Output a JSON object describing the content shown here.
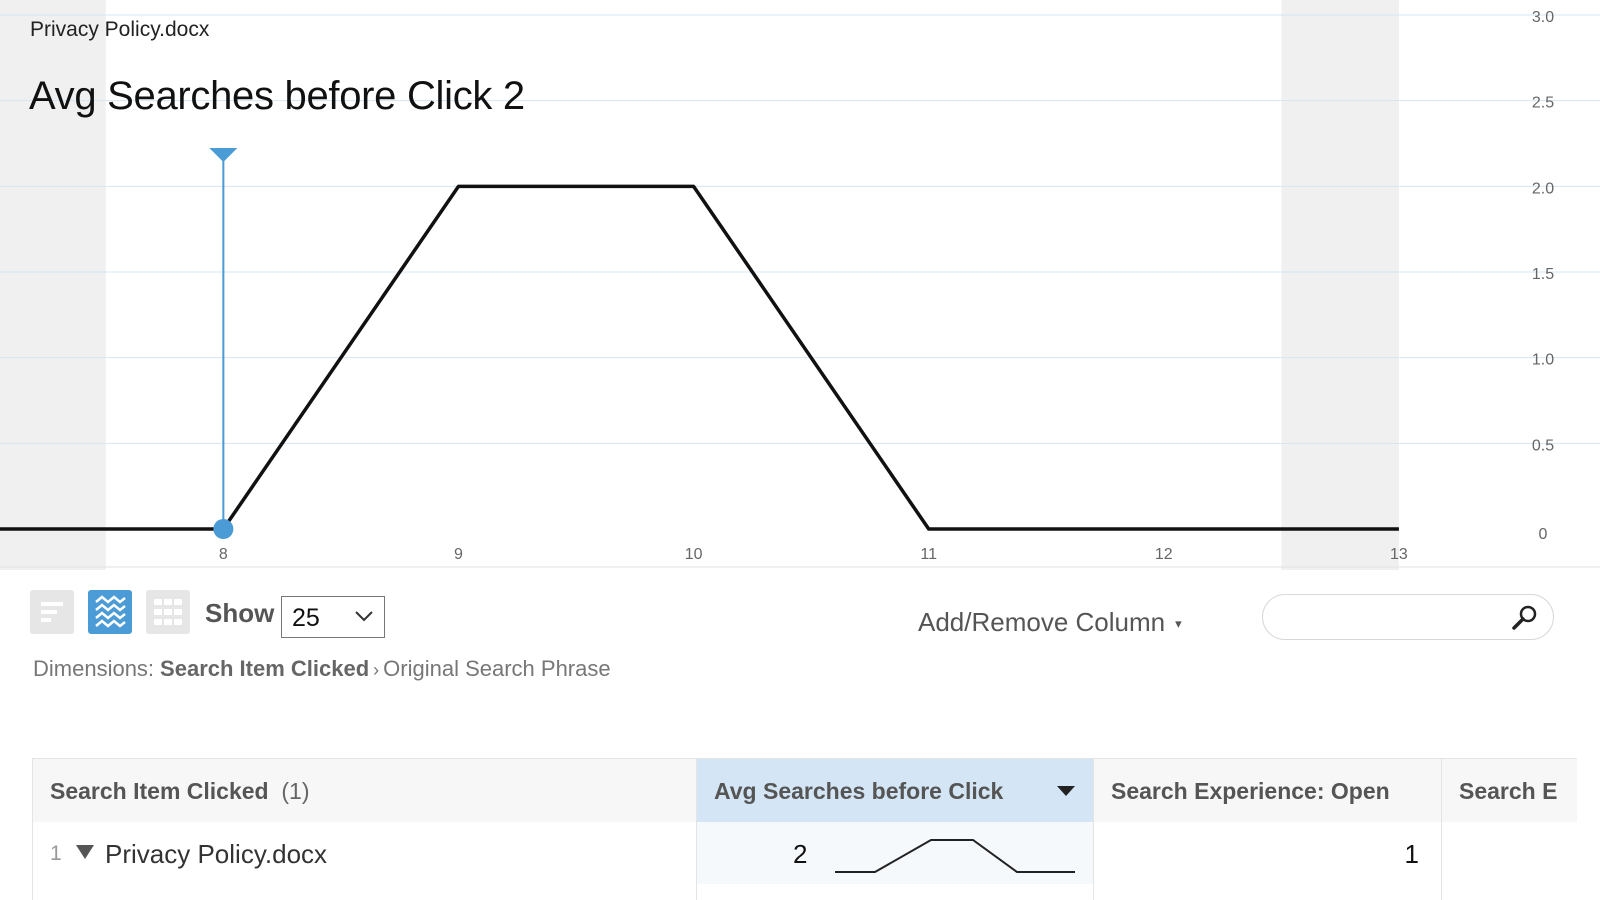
{
  "document_title": "Privacy Policy.docx",
  "metric_title": "Avg Searches before Click 2",
  "chart_data": {
    "type": "line",
    "x": [
      7.05,
      8,
      9,
      10,
      11,
      12,
      13
    ],
    "values": [
      0,
      0,
      2,
      2,
      0,
      0,
      0
    ],
    "x_ticks": [
      "8",
      "9",
      "10",
      "11",
      "12",
      "13"
    ],
    "y_ticks": [
      "0",
      "0.5",
      "1.0",
      "1.5",
      "2.0",
      "2.5",
      "3.0"
    ],
    "xlim": [
      7.05,
      13.6
    ],
    "ylim": [
      0,
      3.0
    ],
    "y_axis_side": "right",
    "grid": true,
    "marker": {
      "x": 8,
      "y": 0
    },
    "line_color": "#111111",
    "marker_color": "#4a9bd6",
    "grid_color": "#d6e6f4",
    "shade_color": "#f0f0f0"
  },
  "toolbar": {
    "show_label": "Show",
    "show_value": "25",
    "add_remove_label": "Add/Remove Column",
    "add_remove_caret": "▾",
    "search_placeholder": "",
    "view_buttons": [
      "ranked-view-icon",
      "trend-view-icon",
      "grid-view-icon"
    ]
  },
  "dimensions": {
    "label": "Dimensions:",
    "primary": "Search Item Clicked",
    "separator": "›",
    "secondary": "Original Search Phrase"
  },
  "table": {
    "columns": [
      {
        "label": "Search Item Clicked",
        "count": "(1)"
      },
      {
        "label": "Avg Searches before Click",
        "sorted": true
      },
      {
        "label": "Search Experience: Open"
      },
      {
        "label": "Search E"
      }
    ],
    "rows": [
      {
        "rank": "1",
        "item": "Privacy Policy.docx",
        "avg_searches": "2",
        "search_experience_open": "1",
        "spark": [
          0,
          0,
          2,
          2,
          0,
          0
        ]
      }
    ]
  },
  "colors": {
    "accent": "#4a9bd6",
    "sorted_header": "#d4e6f5"
  }
}
